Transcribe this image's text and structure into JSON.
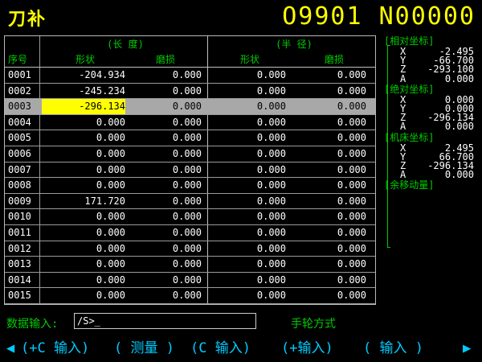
{
  "header": {
    "title": "刀补",
    "program": "O9901 N00000"
  },
  "table": {
    "group_length": "(长  度)",
    "group_radius": "(半  径)",
    "col_no": "序号",
    "col_shape": "形状",
    "col_wear": "磨损",
    "col_shape2": "形状",
    "col_wear2": "磨损",
    "selected_row": 2,
    "rows": [
      [
        "0001",
        "-204.934",
        "0.000",
        "0.000",
        "0.000"
      ],
      [
        "0002",
        "-245.234",
        "0.000",
        "0.000",
        "0.000"
      ],
      [
        "0003",
        "-296.134",
        "0.000",
        "0.000",
        "0.000"
      ],
      [
        "0004",
        "0.000",
        "0.000",
        "0.000",
        "0.000"
      ],
      [
        "0005",
        "0.000",
        "0.000",
        "0.000",
        "0.000"
      ],
      [
        "0006",
        "0.000",
        "0.000",
        "0.000",
        "0.000"
      ],
      [
        "0007",
        "0.000",
        "0.000",
        "0.000",
        "0.000"
      ],
      [
        "0008",
        "0.000",
        "0.000",
        "0.000",
        "0.000"
      ],
      [
        "0009",
        "171.720",
        "0.000",
        "0.000",
        "0.000"
      ],
      [
        "0010",
        "0.000",
        "0.000",
        "0.000",
        "0.000"
      ],
      [
        "0011",
        "0.000",
        "0.000",
        "0.000",
        "0.000"
      ],
      [
        "0012",
        "0.000",
        "0.000",
        "0.000",
        "0.000"
      ],
      [
        "0013",
        "0.000",
        "0.000",
        "0.000",
        "0.000"
      ],
      [
        "0014",
        "0.000",
        "0.000",
        "0.000",
        "0.000"
      ],
      [
        "0015",
        "0.000",
        "0.000",
        "0.000",
        "0.000"
      ]
    ]
  },
  "coords": {
    "relative": {
      "label": "[相对坐标]",
      "X": "-2.495",
      "Y": "-66.700",
      "Z": "-293.100",
      "A": "0.000"
    },
    "absolute": {
      "label": "[绝对坐标]",
      "X": "0.000",
      "Y": "0.000",
      "Z": "-296.134",
      "A": "0.000"
    },
    "machine": {
      "label": "[机床坐标]",
      "X": "2.495",
      "Y": "66.700",
      "Z": "-296.134",
      "A": "0.000"
    },
    "remaining": {
      "label": "[余移动量]"
    },
    "axes": [
      "X",
      "Y",
      "Z",
      "A"
    ]
  },
  "input": {
    "label": "数据输入:",
    "value": "/S>_"
  },
  "mode": "手轮方式",
  "softkeys": {
    "left_arrow": "◀",
    "right_arrow": "▶",
    "keys": [
      "(+C 输入)",
      "( 测量 )",
      "(C 输入)",
      "(+输入)",
      "( 输入 )"
    ]
  },
  "colors": {
    "title": "#ffff00",
    "label": "#00cc00",
    "softkey": "#00ccff",
    "highlight": "#ffff00",
    "selected_row": "#a8a8a8"
  }
}
